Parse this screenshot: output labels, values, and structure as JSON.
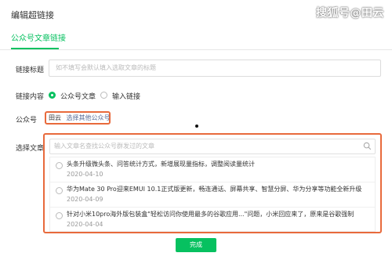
{
  "dialog": {
    "title": "编辑超链接"
  },
  "watermark": "搜狐号@田云",
  "tabs": [
    {
      "label": "公众号文章链接",
      "active": true
    }
  ],
  "form": {
    "link_title": {
      "label": "链接标题",
      "placeholder": "如不填写会默认填入选取文章的标题"
    },
    "link_content": {
      "label": "链接内容",
      "options": [
        {
          "label": "公众号文章",
          "selected": true
        },
        {
          "label": "输入链接",
          "selected": false
        }
      ]
    },
    "account": {
      "label": "公众号",
      "name": "田云",
      "switch_label": "选择其他公众号"
    },
    "article": {
      "label": "选择文章",
      "search_placeholder": "输入文章名查找公众号群发过的文章",
      "items": [
        {
          "title": "头条升级微头条、问答统计方式，新增展现量指标，调整阅读量统计",
          "date": "2020-04-10"
        },
        {
          "title": "华为Mate 30 Pro迎来EMUI 10.1正式版更新，畅连通话、屏幕共享、智慧分屏、华为分享等功能全新升级",
          "date": "2020-04-09"
        },
        {
          "title": "针对小米10pro海外版包装盒\"轻松访问你使用最多的谷歌应用...\"问题，小米回应来了，原来是谷歌强制",
          "date": "2020-04-04"
        }
      ]
    }
  },
  "footer": {
    "done_label": "完成"
  },
  "colors": {
    "accent": "#07c160",
    "highlight": "#e86a3c",
    "link": "#576b95"
  }
}
